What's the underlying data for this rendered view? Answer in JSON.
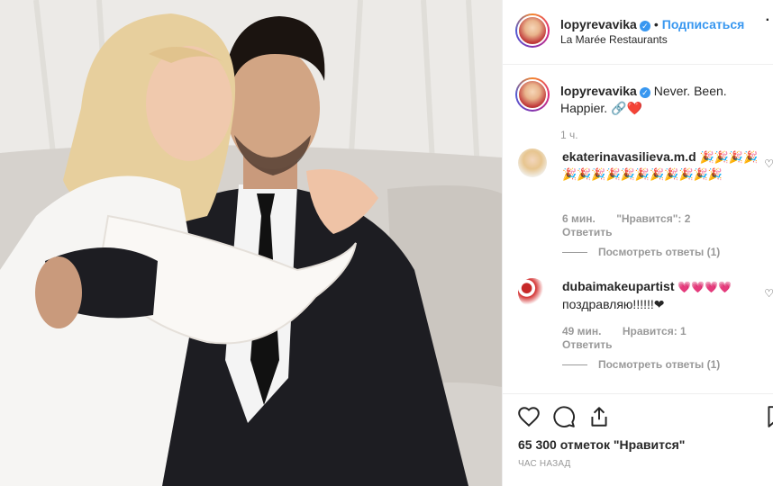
{
  "post": {
    "username": "lopyrevavika",
    "follow_label": "Подписаться",
    "location": "La Marée Restaurants",
    "caption": "Never. Been. Happier. 🔗❤️",
    "caption_time": "1 ч.",
    "likes": "65 300 отметок \"Нравится\"",
    "posted_ago": "ЧАС НАЗАД"
  },
  "comments": [
    {
      "username": "ekaterinavasilieva.m.d",
      "text": "🎉🎉🎉🎉🎉🎉🎉🎉🎉🎉🎉🎉🎉🎉🎉",
      "time": "6 мин.",
      "likes": "\"Нравится\": 2",
      "reply": "Ответить",
      "view_replies": "Посмотреть ответы (1)"
    },
    {
      "username": "dubaimakeupartist",
      "emojis": "💗💗💗💗",
      "text": "поздравляю!!!!!!❤",
      "time": "49 мин.",
      "likes": "Нравится: 1",
      "reply": "Ответить",
      "view_replies": "Посмотреть ответы (1)"
    }
  ],
  "icons": {
    "like": "heart-icon",
    "comment": "comment-icon",
    "share": "share-icon",
    "save": "bookmark-icon",
    "more": "more-icon",
    "verified": "verified-badge-icon"
  },
  "colors": {
    "accent": "#3897f0",
    "text": "#262626",
    "muted": "#999999",
    "heart": "#ed4956"
  }
}
